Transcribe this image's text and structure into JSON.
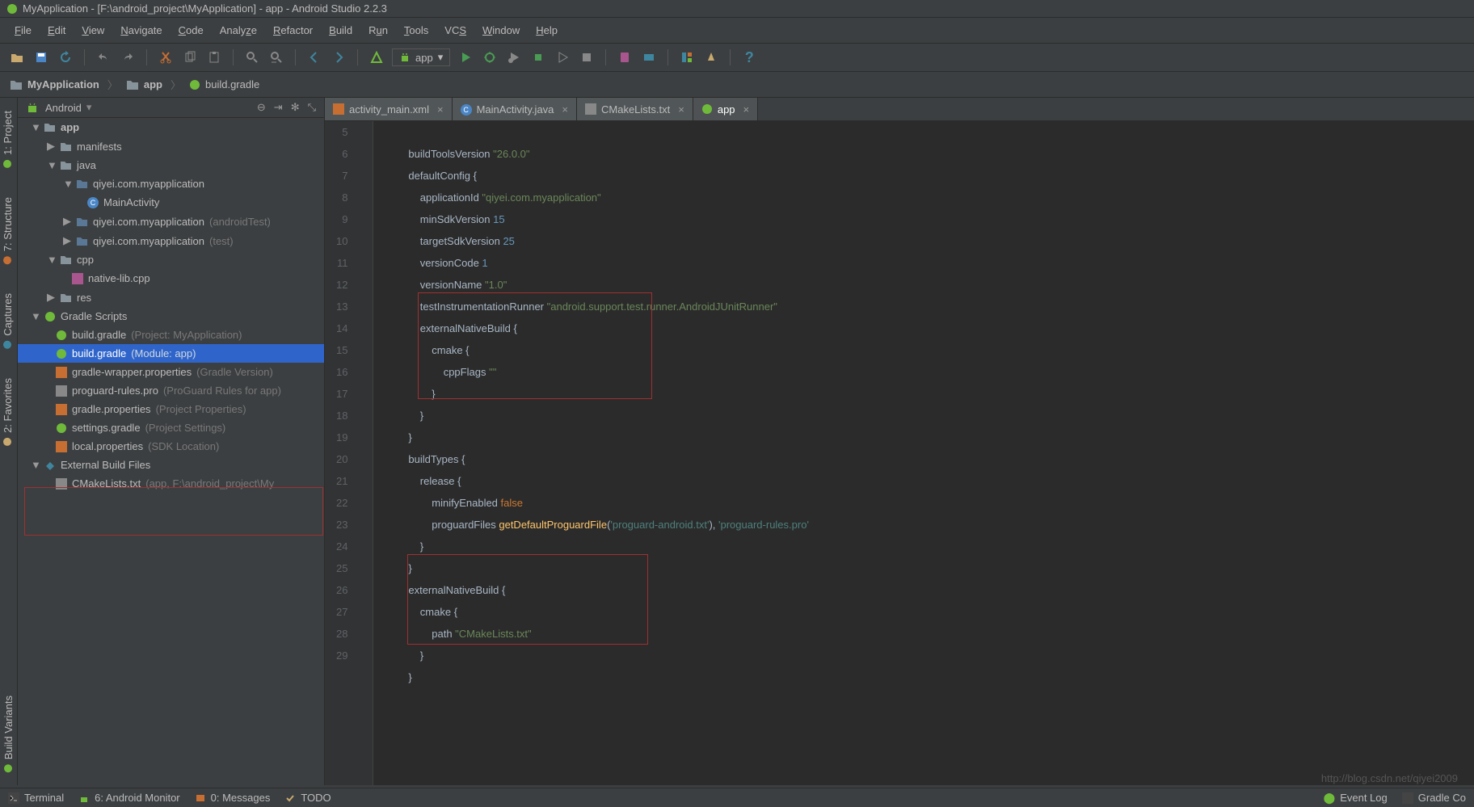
{
  "title": "MyApplication - [F:\\android_project\\MyApplication] - app - Android Studio 2.2.3",
  "menu": [
    "File",
    "Edit",
    "View",
    "Navigate",
    "Code",
    "Analyze",
    "Refactor",
    "Build",
    "Run",
    "Tools",
    "VCS",
    "Window",
    "Help"
  ],
  "runconf": "app",
  "breadcrumb": {
    "a": "MyApplication",
    "b": "app",
    "c": "build.gradle"
  },
  "project_mode": "Android",
  "left_tabs": {
    "project": "1: Project",
    "structure": "7: Structure",
    "captures": "Captures",
    "favorites": "2: Favorites",
    "variants": "Build Variants"
  },
  "tree": {
    "app": "app",
    "manifests": "manifests",
    "java": "java",
    "pkg1": "qiyei.com.myapplication",
    "mainact": "MainActivity",
    "pkg2": "qiyei.com.myapplication",
    "pkg2_note": "(androidTest)",
    "pkg3": "qiyei.com.myapplication",
    "pkg3_note": "(test)",
    "cpp": "cpp",
    "nativelib": "native-lib.cpp",
    "res": "res",
    "gradle_scripts": "Gradle Scripts",
    "bg1": "build.gradle",
    "bg1_note": "(Project: MyApplication)",
    "bg2": "build.gradle",
    "bg2_note": "(Module: app)",
    "gw": "gradle-wrapper.properties",
    "gw_note": "(Gradle Version)",
    "pg": "proguard-rules.pro",
    "pg_note": "(ProGuard Rules for app)",
    "gp": "gradle.properties",
    "gp_note": "(Project Properties)",
    "sg": "settings.gradle",
    "sg_note": "(Project Settings)",
    "lp": "local.properties",
    "lp_note": "(SDK Location)",
    "ext": "External Build Files",
    "cm": "CMakeLists.txt",
    "cm_note": "(app, F:\\android_project\\My"
  },
  "editor_tabs": {
    "t1": "activity_main.xml",
    "t2": "MainActivity.java",
    "t3": "CMakeLists.txt",
    "t4": "app"
  },
  "gutter_start": 5,
  "code": {
    "l5a": "        buildToolsVersion ",
    "l5b": "\"26.0.0\"",
    "l6a": "        defaultConfig ",
    "l6b": "{",
    "l7a": "            applicationId ",
    "l7b": "\"qiyei.com.myapplication\"",
    "l8a": "            minSdkVersion ",
    "l8b": "15",
    "l9a": "            targetSdkVersion ",
    "l9b": "25",
    "l10a": "            versionCode ",
    "l10b": "1",
    "l11a": "            versionName ",
    "l11b": "\"1.0\"",
    "l12a": "            testInstrumentationRunner ",
    "l12b": "\"android.support.test.runner.AndroidJUnitRunner\"",
    "l13a": "            externalNativeBuild ",
    "l13b": "{",
    "l14a": "                cmake ",
    "l14b": "{",
    "l15a": "                    cppFlags ",
    "l15b": "\"\"",
    "l16": "                }",
    "l17": "            }",
    "l18": "        }",
    "l19a": "        buildTypes ",
    "l19b": "{",
    "l20a": "            release ",
    "l20b": "{",
    "l21a": "                minifyEnabled ",
    "l21b": "false",
    "l22a": "                proguardFiles ",
    "l22b": "getDefaultProguardFile",
    "l22c": "(",
    "l22d": "'proguard-android.txt'",
    "l22e": "), ",
    "l22f": "'proguard-rules.pro'",
    "l23": "            }",
    "l24": "        }",
    "l25a": "        externalNativeBuild ",
    "l25b": "{",
    "l26a": "            cmake ",
    "l26b": "{",
    "l27a": "                path ",
    "l27b": "\"CMakeLists.txt\"",
    "l28": "            }",
    "l29": "        }"
  },
  "status": {
    "terminal": "Terminal",
    "monitor": "6: Android Monitor",
    "messages": "0: Messages",
    "todo": "TODO",
    "eventlog": "Event Log",
    "gradlec": "Gradle Co"
  },
  "watermark": "http://blog.csdn.net/qiyei2009"
}
